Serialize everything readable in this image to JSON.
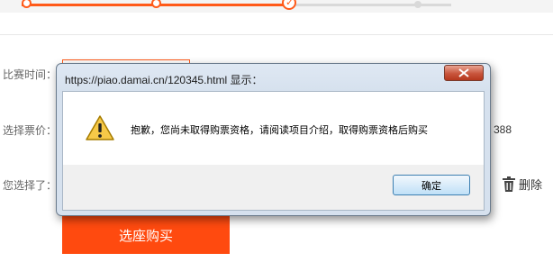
{
  "page": {
    "labels": {
      "date": "比赛时间：",
      "price": "选择票价：",
      "selected": "您选择了："
    },
    "price_fragment": "388",
    "delete_label": "删除",
    "seat_button_label": "选座购买"
  },
  "dialog": {
    "title": "https://piao.damai.cn/120345.html 显示：",
    "message": "抱歉，您尚未取得购票资格，请阅读项目介绍，取得购票资格后购买",
    "ok_label": "确定"
  },
  "icons": {
    "warning": "warning-icon",
    "close": "close-icon",
    "trash": "trash-icon",
    "check": "check-icon"
  },
  "colors": {
    "accent": "#ff5a19",
    "seat_button": "#ff4a0f"
  }
}
